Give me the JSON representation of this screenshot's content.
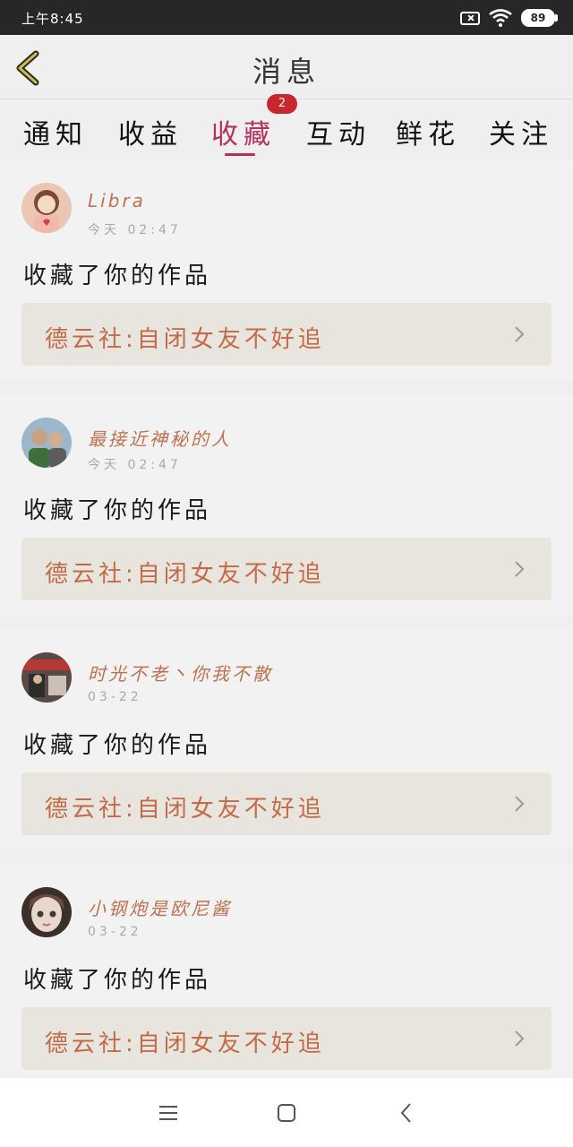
{
  "status": {
    "time": "上午8:45",
    "battery": "89"
  },
  "header": {
    "title": "消息"
  },
  "tabs": [
    {
      "label": "通知"
    },
    {
      "label": "收益"
    },
    {
      "label": "收藏"
    },
    {
      "label": "互动"
    },
    {
      "label": "鲜花"
    },
    {
      "label": "关注"
    }
  ],
  "tab_badge": "2",
  "active_tab": "收藏",
  "colors": {
    "accent": "#b5315c",
    "username": "#c0714f",
    "badge": "#c8272d"
  },
  "items": [
    {
      "user": "Libra",
      "time": "今天 02:47",
      "action": "收藏了你的作品",
      "work": "德云社:自闭女友不好追"
    },
    {
      "user": "最接近神秘的人",
      "time": "今天 02:47",
      "action": "收藏了你的作品",
      "work": "德云社:自闭女友不好追"
    },
    {
      "user": "时光不老丶你我不散",
      "time": "03-22",
      "action": "收藏了你的作品",
      "work": "德云社:自闭女友不好追"
    },
    {
      "user": "小钢炮是欧尼酱",
      "time": "03-22",
      "action": "收藏了你的作品",
      "work": "德云社:自闭女友不好追"
    }
  ],
  "icons": {
    "back": "back-arrow-icon",
    "chevron": "chevron-right-icon",
    "nav": [
      "menu-icon",
      "home-square-icon",
      "back-triangle-icon"
    ]
  }
}
